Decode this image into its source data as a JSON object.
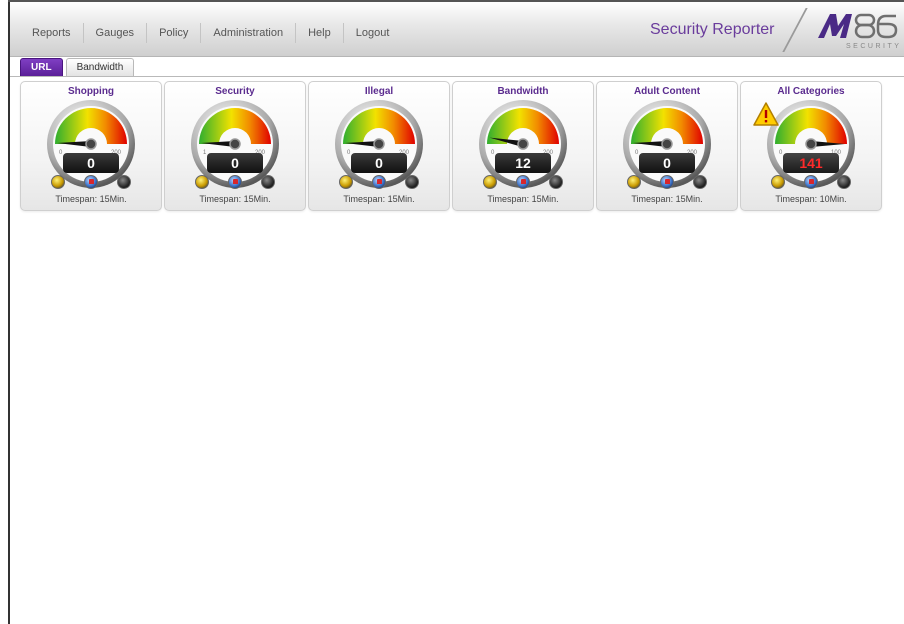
{
  "app": {
    "title": "Security Reporter",
    "brand_color": "#6a3c9c",
    "logo_text": "M86 SECURITY"
  },
  "menu": {
    "items": [
      {
        "label": "Reports"
      },
      {
        "label": "Gauges"
      },
      {
        "label": "Policy"
      },
      {
        "label": "Administration"
      },
      {
        "label": "Help"
      },
      {
        "label": "Logout"
      }
    ]
  },
  "tabs": [
    {
      "label": "URL",
      "active": true
    },
    {
      "label": "Bandwidth",
      "active": false
    }
  ],
  "gauges": [
    {
      "title": "Shopping",
      "value": "0",
      "scale_min": "0",
      "scale_max": "200",
      "timespan": "Timespan: 15Min.",
      "alert": false
    },
    {
      "title": "Security",
      "value": "0",
      "scale_min": "1",
      "scale_max": "200",
      "timespan": "Timespan: 15Min.",
      "alert": false
    },
    {
      "title": "Illegal",
      "value": "0",
      "scale_min": "0",
      "scale_max": "200",
      "timespan": "Timespan: 15Min.",
      "alert": false
    },
    {
      "title": "Bandwidth",
      "value": "12",
      "scale_min": "0",
      "scale_max": "200",
      "timespan": "Timespan: 15Min.",
      "alert": false
    },
    {
      "title": "Adult Content",
      "value": "0",
      "scale_min": "0",
      "scale_max": "200",
      "timespan": "Timespan: 15Min.",
      "alert": false
    },
    {
      "title": "All Categories",
      "value": "141",
      "scale_min": "0",
      "scale_max": "100",
      "timespan": "Timespan: 10Min.",
      "alert": true
    }
  ],
  "icons": {
    "gauge_buttons": [
      "edit-gauge-icon",
      "chart-icon",
      "power-off-icon"
    ],
    "alert": "warning-icon"
  },
  "colors": {
    "tab_active": "#6a2cad",
    "alert_value": "#ff2a2a",
    "gauge_low": "#2fae2f",
    "gauge_mid": "#f2e200",
    "gauge_high": "#e00000"
  }
}
